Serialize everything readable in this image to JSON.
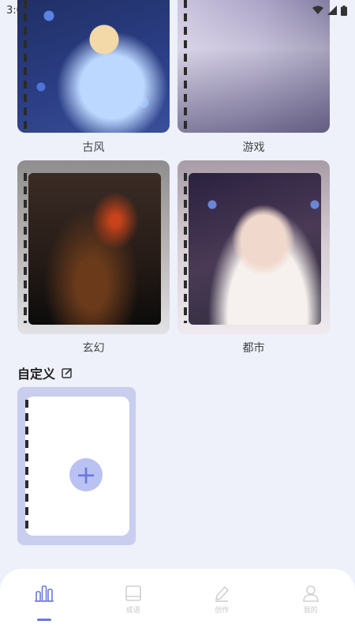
{
  "status_bar": {
    "time": "3:07"
  },
  "categories": [
    {
      "label": "古风"
    },
    {
      "label": "游戏"
    },
    {
      "label": "玄幻"
    },
    {
      "label": "都市"
    }
  ],
  "custom_section": {
    "title": "自定义",
    "add_symbol": "+"
  },
  "bottom_nav": {
    "items": [
      {
        "label": "",
        "icon": "chart-icon",
        "active": true
      },
      {
        "label": "成语",
        "icon": "book-icon",
        "active": false
      },
      {
        "label": "创作",
        "icon": "pencil-icon",
        "active": false
      },
      {
        "label": "我的",
        "icon": "user-icon",
        "active": false
      }
    ]
  },
  "colors": {
    "accent": "#6a78e0",
    "background": "#eef0fa",
    "inactive": "#c8c8d0"
  }
}
